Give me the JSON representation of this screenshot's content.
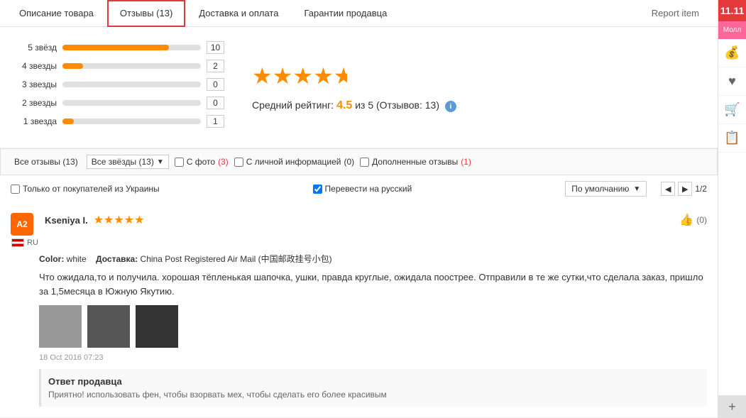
{
  "tabs": {
    "items": [
      {
        "id": "description",
        "label": "Описание товара",
        "active": false
      },
      {
        "id": "reviews",
        "label": "Отзывы (13)",
        "active": true
      },
      {
        "id": "delivery",
        "label": "Доставка и оплата",
        "active": false
      },
      {
        "id": "guarantee",
        "label": "Гарантии продавца",
        "active": false
      }
    ],
    "report_label": "Report item"
  },
  "rating": {
    "bars": [
      {
        "label": "5 звёзд",
        "count": 10,
        "pct": 77
      },
      {
        "label": "4 звезды",
        "count": 2,
        "pct": 15
      },
      {
        "label": "3 звезды",
        "count": 0,
        "pct": 0
      },
      {
        "label": "2 звезды",
        "count": 0,
        "pct": 0
      },
      {
        "label": "1 звезда",
        "count": 1,
        "pct": 8
      }
    ],
    "average": "4.5",
    "avg_text": "из 5",
    "reviews_label": "(Отзывов: 13)",
    "avg_label": "Средний рейтинг:"
  },
  "filters": {
    "all_reviews": "Все отзывы (13)",
    "all_stars": "Все звёзды (13)",
    "with_photo_label": "С фото",
    "with_photo_count": "(3)",
    "with_info_label": "С личной информацией",
    "with_info_count": "(0)",
    "additional_label": "Дополненные отзывы",
    "additional_count": "(1)"
  },
  "options": {
    "ukraine_only_label": "Только от покупателей из Украины",
    "translate_label": "Перевести на русский",
    "sort_label": "По умолчанию",
    "page_current": "1",
    "page_total": "2"
  },
  "reviews": [
    {
      "avatar": "A2",
      "name": "Kseniya I.",
      "country": "RU",
      "stars": 5,
      "color_label": "Color:",
      "color_value": "white",
      "delivery_label": "Доставка:",
      "delivery_value": "China Post Registered Air Mail (中国邮政挂号小包)",
      "text": "Что ожидала,то и получила. хорошая тёпленькая шапочка, ушки, правда круглые, ожидала поострее. Отправили в те же сутки,что сделала заказ, пришло за 1,5месяца в Южную Якутию.",
      "date": "18 Oct 2016 07:23",
      "likes": "(0)",
      "seller_response_title": "Ответ продавца",
      "seller_response_text": "Приятно! использовать фен, чтобы взорвать мех, чтобы сделать его более красивым"
    }
  ],
  "sidebar": {
    "red_box": "11.11",
    "molл_label": "Молл",
    "icons": [
      "💰",
      "♥",
      "🛒",
      "📋"
    ]
  }
}
